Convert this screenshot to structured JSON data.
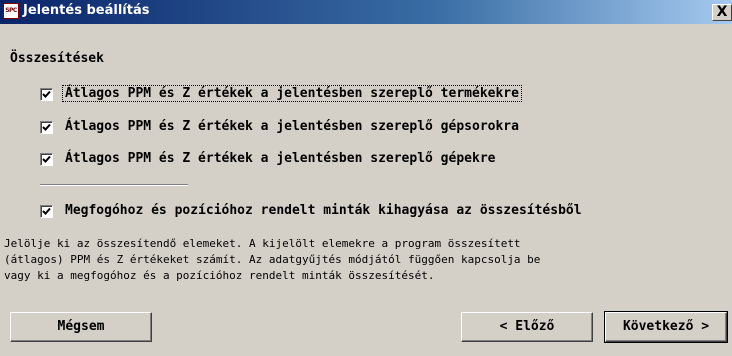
{
  "window": {
    "icon_text": "SPC",
    "title": "Jelentés beállítás",
    "close_glyph": "X"
  },
  "section_title": "Összesítések",
  "checkboxes": [
    {
      "label": "Átlagos PPM és Z értékek a jelentésben szereplő termékekre",
      "checked": true,
      "focused": true
    },
    {
      "label": "Átlagos PPM és Z értékek a jelentésben szereplő gépsorokra",
      "checked": true,
      "focused": false
    },
    {
      "label": "Átlagos PPM és Z értékek a jelentésben szereplő gépekre",
      "checked": true,
      "focused": false
    },
    {
      "label": "Megfogóhoz és pozícióhoz rendelt minták kihagyása az összesítésből",
      "checked": true,
      "focused": false
    }
  ],
  "description": "Jelölje ki az összesítendő elemeket. A kijelölt elemekre a program összesített\n(átlagos) PPM és Z értékeket számít. Az adatgyűjtés módjától függően kapcsolja be\nvagy ki a megfogóhoz és a pozícióhoz rendelt minták összesítését.",
  "buttons": {
    "cancel": "Mégsem",
    "prev": "< Előző",
    "next": "Következő >"
  },
  "check_icon": "check-mark-icon"
}
